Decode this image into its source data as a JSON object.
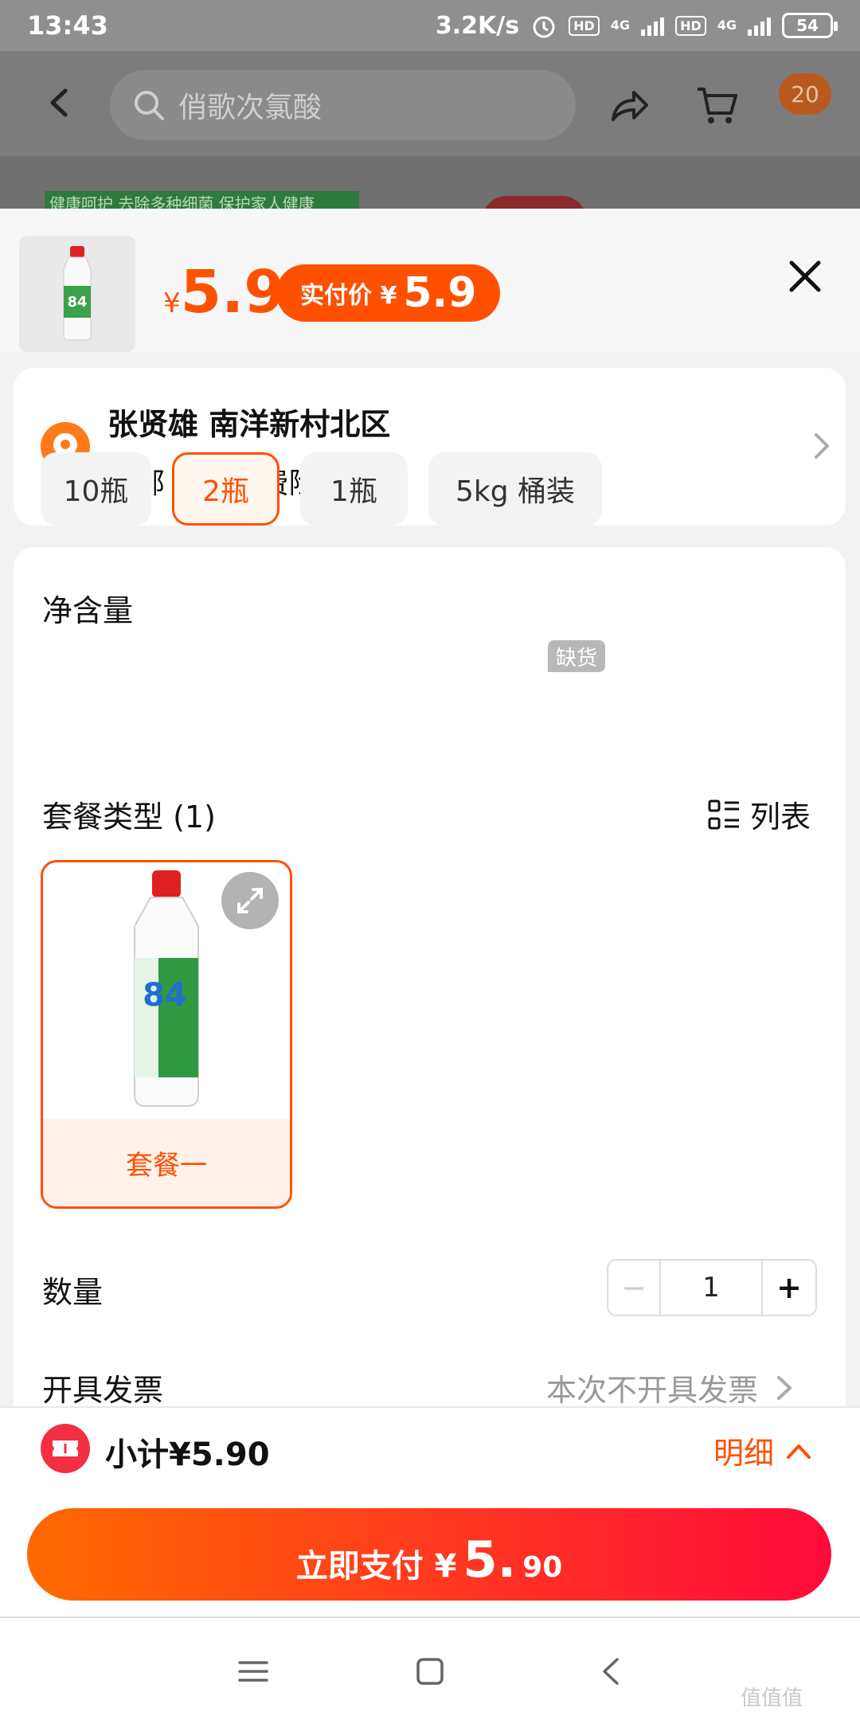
{
  "status_bar": {
    "time": "13:43",
    "speed": "3.2K/s",
    "hd1": "HD",
    "net1": "4G",
    "hd2": "HD",
    "net2": "4G",
    "battery": "54"
  },
  "header": {
    "search_placeholder": "俏歌次氯酸",
    "cart_count": "20",
    "banner_text": "健康呵护 去除多种细菌 保护家人健康"
  },
  "product": {
    "currency": "¥",
    "price": "5.9",
    "pay_label": "实付价 ¥",
    "pay_price": "5.9"
  },
  "address": {
    "name": "张贤雄 南洋新村北区",
    "shipping": "包邮  可选运费险"
  },
  "spec": {
    "net_title": "净含量",
    "options": [
      {
        "label": "10瓶",
        "selected": false
      },
      {
        "label": "2瓶",
        "selected": true
      },
      {
        "label": "1瓶",
        "selected": false
      },
      {
        "label": "5kg 桶装",
        "selected": false
      }
    ],
    "out_of_stock": "缺货",
    "package_title": "套餐类型 (1)",
    "list_label": "列表",
    "package_name": "套餐一",
    "quantity_label": "数量",
    "quantity": "1",
    "minus": "−",
    "plus": "+",
    "invoice_label": "开具发票",
    "invoice_value": "本次不开具发票"
  },
  "footer": {
    "subtotal": "小计¥5.90",
    "detail": "明细",
    "pay_label": "立即支付 ¥",
    "pay_int": "5.",
    "pay_dec": "90"
  },
  "watermark": "值值值",
  "colors": {
    "accent": "#ff5000",
    "pay_gradient_start": "#ff6a00",
    "pay_gradient_end": "#ff0a3c"
  }
}
